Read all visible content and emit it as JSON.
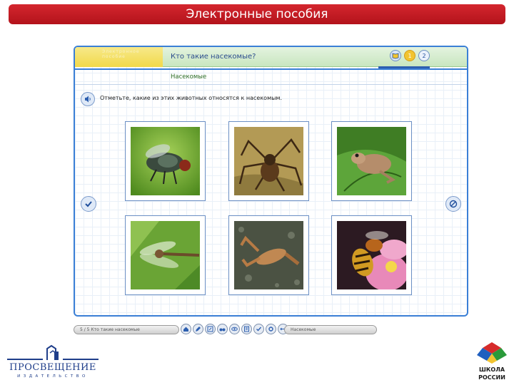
{
  "slide": {
    "title": "Электронные пособия",
    "banner_color": "#c41d25"
  },
  "app": {
    "brand_tab_text": "Электронное пособие",
    "question_title": "Кто такие насекомые?",
    "section_label": "Насекомые",
    "instruction": "Отметьте, какие из этих животных относятся к насекомым.",
    "nav": [
      {
        "name": "book-icon",
        "label": ""
      },
      {
        "name": "step-1",
        "label": "1"
      },
      {
        "name": "step-2",
        "label": "2"
      }
    ],
    "accent": "#3a7fd6"
  },
  "cards": [
    {
      "name": "fly",
      "icon": "fly-photo"
    },
    {
      "name": "spider",
      "icon": "spider-photo"
    },
    {
      "name": "frog",
      "icon": "frog-photo"
    },
    {
      "name": "dragonfly",
      "icon": "dragonfly-photo"
    },
    {
      "name": "crayfish",
      "icon": "crayfish-photo"
    },
    {
      "name": "wasp",
      "icon": "wasp-photo"
    }
  ],
  "footer": {
    "status_left": "5 / 5   Кто такие насекомые",
    "status_right": "Насекомые",
    "tools": [
      "home-icon",
      "pencil-icon",
      "edit-icon",
      "binoculars-icon",
      "eye-icon",
      "notes-icon",
      "check-icon",
      "settings-icon",
      "arrows-icon"
    ]
  },
  "publisher": {
    "name": "ПРОСВЕЩЕНИЕ",
    "subtitle": "ИЗДАТЕЛЬСТВО"
  },
  "school": {
    "line1": "ШКОЛА",
    "line2": "РОССИИ"
  }
}
